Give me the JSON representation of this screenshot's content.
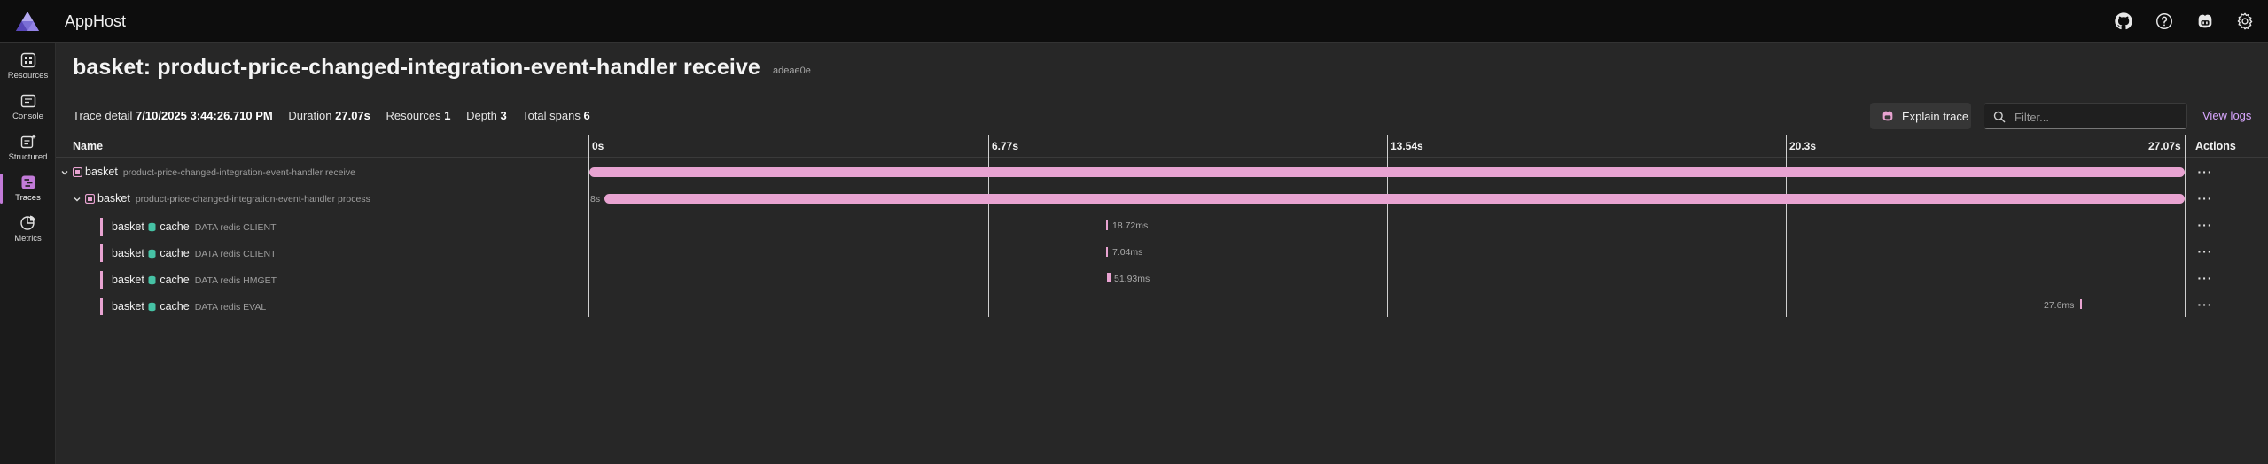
{
  "app": {
    "title": "AppHost"
  },
  "nav": [
    {
      "label": "Resources",
      "icon": "resources-icon"
    },
    {
      "label": "Console",
      "icon": "console-icon"
    },
    {
      "label": "Structured",
      "icon": "structured-icon"
    },
    {
      "label": "Traces",
      "icon": "traces-icon",
      "active": true
    },
    {
      "label": "Metrics",
      "icon": "metrics-icon"
    }
  ],
  "header": {
    "title": "basket: product-price-changed-integration-event-handler receive",
    "trace_id": "adeae0e"
  },
  "meta": {
    "trace_detail_label": "Trace detail",
    "trace_detail_value": "7/10/2025 3:44:26.710 PM",
    "duration_label": "Duration",
    "duration_value": "27.07s",
    "resources_label": "Resources",
    "resources_value": "1",
    "depth_label": "Depth",
    "depth_value": "3",
    "total_spans_label": "Total spans",
    "total_spans_value": "6"
  },
  "toolbar": {
    "explain_label": "Explain trace",
    "filter_placeholder": "Filter...",
    "view_logs_label": "View logs"
  },
  "table": {
    "name_header": "Name",
    "actions_header": "Actions",
    "ticks": [
      "0s",
      "6.77s",
      "13.54s",
      "20.3s",
      "27.07s"
    ],
    "actions_label": "···",
    "rows": [
      {
        "service": "basket",
        "target": "",
        "detail": "product-price-changed-integration-event-handler receive",
        "duration": "",
        "start_label": ""
      },
      {
        "service": "basket",
        "target": "",
        "detail": "product-price-changed-integration-event-handler process",
        "duration": "",
        "start_label": "8s"
      },
      {
        "service": "basket",
        "target": "cache",
        "detail": "DATA redis CLIENT",
        "duration": "18.72ms",
        "start_label": ""
      },
      {
        "service": "basket",
        "target": "cache",
        "detail": "DATA redis CLIENT",
        "duration": "7.04ms",
        "start_label": ""
      },
      {
        "service": "basket",
        "target": "cache",
        "detail": "DATA redis HMGET",
        "duration": "51.93ms",
        "start_label": ""
      },
      {
        "service": "basket",
        "target": "cache",
        "detail": "DATA redis EVAL",
        "duration": "27.6ms",
        "start_label": ""
      }
    ]
  },
  "colors": {
    "accent": "#c27bd8",
    "span": "#e8a3d1",
    "link": "#d9a7ff"
  }
}
